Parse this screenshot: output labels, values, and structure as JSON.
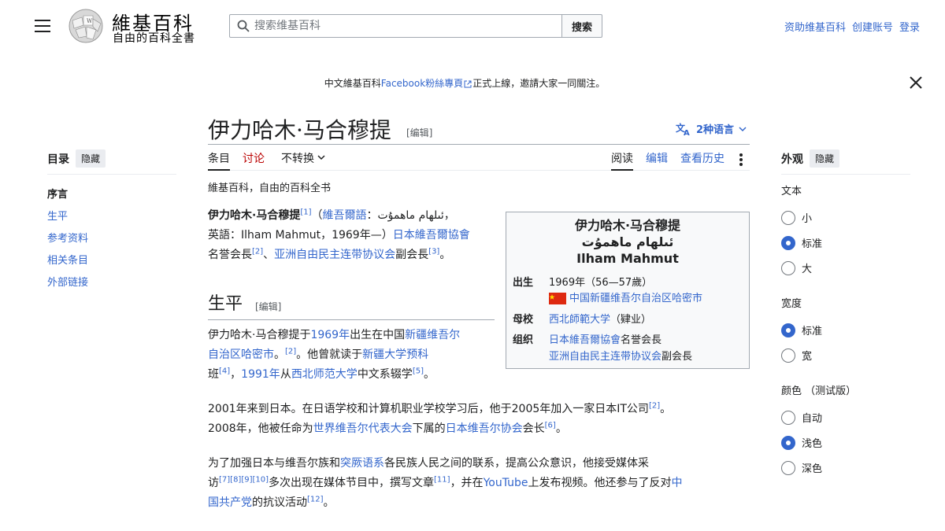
{
  "header": {
    "wordmark": "維基百科",
    "tagline": "自由的百科全書",
    "search_placeholder": "搜索维基百科",
    "search_button": "搜索",
    "user_links": [
      "资助维基百科",
      "创建账号",
      "登录"
    ]
  },
  "notice": {
    "prefix": "中文維基百科",
    "link": "Facebook粉絲專頁",
    "suffix": "正式上線，邀請大家一同關注。"
  },
  "toc": {
    "title": "目录",
    "hide": "隐藏",
    "items": [
      "序言",
      "生平",
      "参考资料",
      "相关条目",
      "外部链接"
    ]
  },
  "article": {
    "title": "伊力哈木·马合穆提",
    "edit": "[编辑]",
    "languages": "2种语言",
    "tabs": {
      "article": "条目",
      "talk": "讨论",
      "variant": "不转换",
      "read": "阅读",
      "edit": "编辑",
      "history": "查看历史"
    },
    "subtitle": "維基百科，自由的百科全书",
    "intro": {
      "name": "伊力哈木·马合穆提",
      "r1": "[1]",
      "t1": "（",
      "l1": "維吾爾語",
      "t2": "：ئىلھام ماھمۇت，",
      "t3": "英語：Ilham Mahmut，1969年—）",
      "l2": "日本維吾爾協會",
      "t4": "名誉会長",
      "r2": "[2]",
      "t5": "、",
      "l3": "亚洲自由民主连带协议会",
      "t6": "副会長",
      "r3": "[3]",
      "t7": "。"
    },
    "section_title": "生平",
    "section_edit": "[编辑]",
    "p1": {
      "t1": "伊力哈木·马合穆提于",
      "l1": "1969年",
      "t2": "出生在中国",
      "l2": "新疆维吾尔",
      "l2b": "自治区哈密市",
      "t3": "。",
      "r1": "[2]",
      "t4": "。他曾就读于",
      "l3": "新疆大学预科",
      "t5": "班",
      "r2": "[4]",
      "t6": "，",
      "l4": "1991年",
      "t7": "从",
      "l5": "西北师范大学",
      "t8": "中文系辍学",
      "r3": "[5]",
      "t9": "。"
    },
    "p2": {
      "t1": "2001年来到日本。在日语学校和计算机职业学校学习后，他于2005年加入一家日本IT公司",
      "r1": "[2]",
      "t2": "。",
      "t3": "2008年，他被任命为",
      "l1": "世界维吾尔代表大会",
      "t4": "下属的",
      "l2": "日本维吾尔协会",
      "t5": "会长",
      "r2": "[6]",
      "t6": "。"
    },
    "p3": {
      "t1": "为了加强日本与维吾尔族和",
      "l1": "突厥语系",
      "t2": "各民族人民之间的联系，提高公众意识，他接受媒体采",
      "t3": "访",
      "r1": "[7][8][9][10]",
      "t4": "多次出现在媒体节目中，撰写文章",
      "r2": "[11]",
      "t5": "，并在",
      "l2": "YouTube",
      "t6": "上发布视频。他还参与了反对",
      "l3": "中",
      "l3b": "国共产党",
      "t7": "的抗议活动",
      "r3": "[12]",
      "t8": "。"
    }
  },
  "infobox": {
    "title_cn": "伊力哈木·马合穆提",
    "title_ug": "ئىلھام ماھمۇت",
    "title_en": "Ilham Mahmut",
    "born_label": "出生",
    "born_value": "1969年（56—57歲）",
    "born_place": "中国新疆维吾尔自治区哈密市",
    "school_label": "母校",
    "school_link": "西北師範大学",
    "school_note": "（肄业）",
    "org_label": "组织",
    "org1_link": "日本維吾爾協會",
    "org1_note": "名誉会長",
    "org2_link": "亚洲自由民主连带协议会",
    "org2_note": "副会長"
  },
  "appearance": {
    "title": "外观",
    "hide": "隐藏",
    "text_label": "文本",
    "text_options": [
      "小",
      "标准",
      "大"
    ],
    "width_label": "宽度",
    "width_options": [
      "标准",
      "宽"
    ],
    "color_label": "颜色 （测试版）",
    "color_options": [
      "自动",
      "浅色",
      "深色"
    ]
  },
  "colors": {
    "link": "#3366cc",
    "talk": "#ba0000",
    "accent": "#3366cc"
  }
}
